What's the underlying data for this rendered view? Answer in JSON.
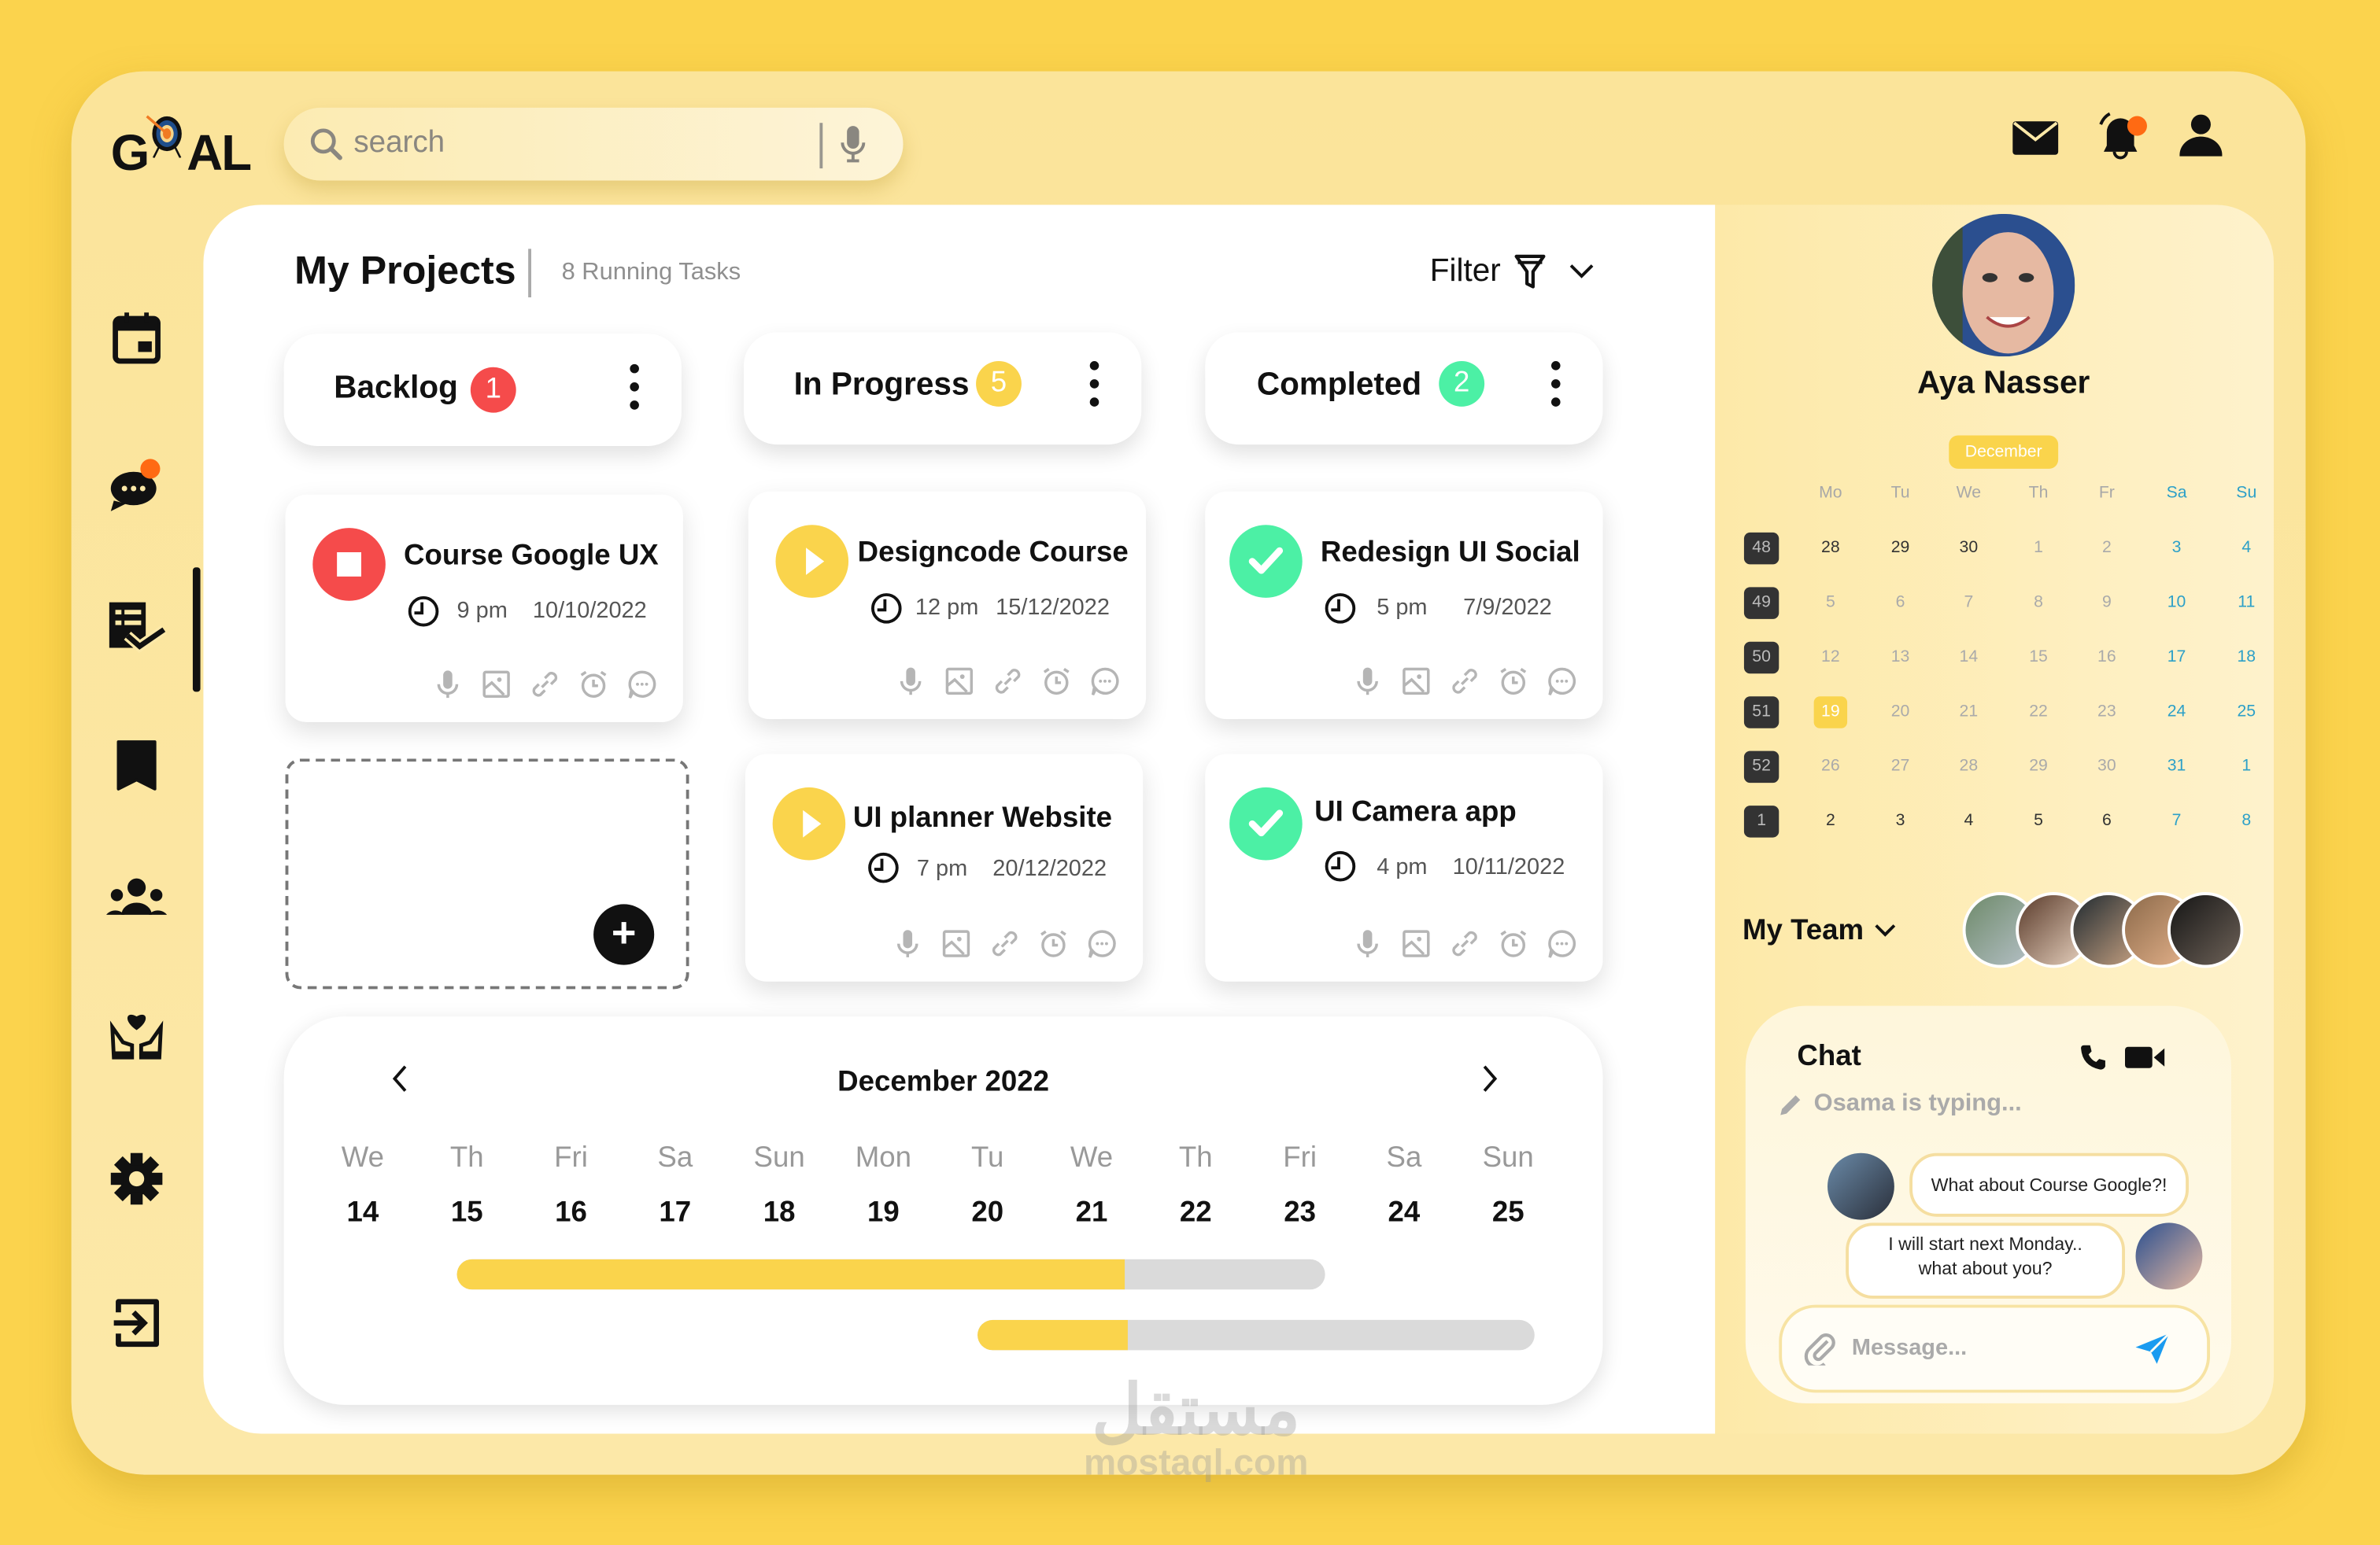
{
  "app": {
    "logo_text_left": "G",
    "logo_text_right": "AL"
  },
  "search": {
    "placeholder": "search"
  },
  "topbar": {
    "icons": [
      "mail-icon",
      "bell-icon",
      "user-icon"
    ],
    "notification_dot_color": "#ff6a13"
  },
  "sidebar": {
    "items": [
      {
        "name": "calendar",
        "icon": "calendar-icon"
      },
      {
        "name": "messages",
        "icon": "chat-icon",
        "has_badge": true
      },
      {
        "name": "tasks",
        "icon": "task-checklist-icon",
        "active": true
      },
      {
        "name": "bookmarks",
        "icon": "bookmark-icon"
      },
      {
        "name": "team",
        "icon": "team-icon"
      },
      {
        "name": "care",
        "icon": "hands-heart-icon"
      },
      {
        "name": "settings",
        "icon": "gear-icon"
      },
      {
        "name": "logout",
        "icon": "logout-icon"
      }
    ]
  },
  "projects": {
    "title": "My Projects",
    "subtitle": "8 Running Tasks",
    "filter_label": "Filter"
  },
  "columns": [
    {
      "label": "Backlog",
      "count": "1",
      "color": "#f54b4b"
    },
    {
      "label": "In Progress",
      "count": "5",
      "color": "#fad44c"
    },
    {
      "label": "Completed",
      "count": "2",
      "color": "#4cf0a5"
    }
  ],
  "cards": [
    {
      "title": "Course Google UX",
      "time": "9 pm",
      "date": "10/10/2022",
      "status": "stopped",
      "column": "Backlog"
    },
    {
      "title": "Designcode Course",
      "time": "12 pm",
      "date": "15/12/2022",
      "status": "in-progress",
      "column": "In Progress"
    },
    {
      "title": "Redesign UI Social",
      "time": "5 pm",
      "date": "7/9/2022",
      "status": "completed",
      "column": "Completed"
    },
    {
      "title": "UI planner Website",
      "time": "7 pm",
      "date": "20/12/2022",
      "status": "in-progress",
      "column": "In Progress"
    },
    {
      "title": "UI Camera app",
      "time": "4 pm",
      "date": "10/11/2022",
      "status": "completed",
      "column": "Completed"
    }
  ],
  "card_tools": [
    "mic-icon",
    "image-icon",
    "link-icon",
    "alarm-icon",
    "comment-icon"
  ],
  "add_task": {
    "icon": "plus-icon"
  },
  "timeline": {
    "month": "December 2022",
    "days": [
      {
        "d": "We",
        "n": "14"
      },
      {
        "d": "Th",
        "n": "15"
      },
      {
        "d": "Fri",
        "n": "16"
      },
      {
        "d": "Sa",
        "n": "17"
      },
      {
        "d": "Sun",
        "n": "18"
      },
      {
        "d": "Mon",
        "n": "19"
      },
      {
        "d": "Tu",
        "n": "20"
      },
      {
        "d": "We",
        "n": "21"
      },
      {
        "d": "Th",
        "n": "22"
      },
      {
        "d": "Fri",
        "n": "23"
      },
      {
        "d": "Sa",
        "n": "24"
      },
      {
        "d": "Sun",
        "n": "25"
      }
    ],
    "bars": [
      {
        "start_day": "15",
        "end_day": "23",
        "progress": 0.77
      },
      {
        "start_day": "20",
        "end_day": "25",
        "progress": 0.27
      }
    ]
  },
  "profile": {
    "name": "Aya Nasser"
  },
  "mini_calendar": {
    "month": "December",
    "headers": [
      "Mo",
      "Tu",
      "We",
      "Th",
      "Fr",
      "Sa",
      "Su"
    ],
    "weeks": [
      {
        "wk": "48",
        "days": [
          "28",
          "29",
          "30",
          "1",
          "2",
          "3",
          "4"
        ]
      },
      {
        "wk": "49",
        "days": [
          "5",
          "6",
          "7",
          "8",
          "9",
          "10",
          "11"
        ]
      },
      {
        "wk": "50",
        "days": [
          "12",
          "13",
          "14",
          "15",
          "16",
          "17",
          "18"
        ]
      },
      {
        "wk": "51",
        "days": [
          "19",
          "20",
          "21",
          "22",
          "23",
          "24",
          "25"
        ]
      },
      {
        "wk": "52",
        "days": [
          "26",
          "27",
          "28",
          "29",
          "30",
          "31",
          "1"
        ]
      },
      {
        "wk": "1",
        "days": [
          "2",
          "3",
          "4",
          "5",
          "6",
          "7",
          "8"
        ]
      }
    ],
    "selected": "19"
  },
  "team": {
    "label": "My Team",
    "member_count": 5
  },
  "chat": {
    "title": "Chat",
    "typing": "Osama  is typing...",
    "messages": [
      {
        "from": "other",
        "text": "What about Course Google?!"
      },
      {
        "from": "me",
        "text_line1": "I will start next Monday..",
        "text_line2": "what about you?"
      }
    ],
    "input_placeholder": "Message..."
  },
  "watermark": {
    "arabic": "مستقل",
    "latin": "mostaql.com"
  }
}
